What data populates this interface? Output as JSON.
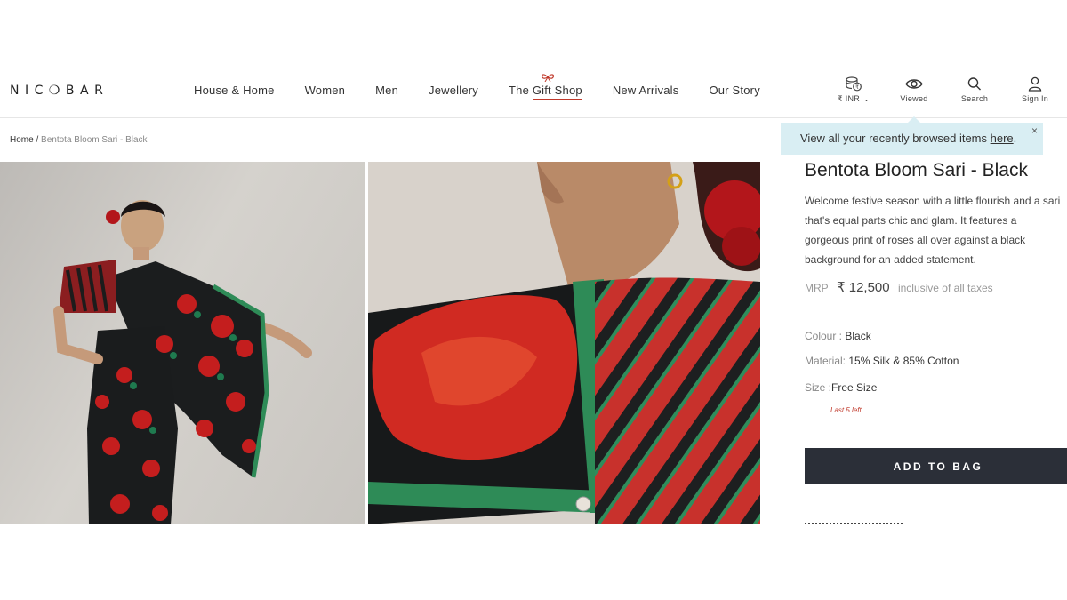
{
  "brand": {
    "logo_text": "NIC❍BAR"
  },
  "nav": {
    "items": [
      {
        "label": "House & Home"
      },
      {
        "label": "Women"
      },
      {
        "label": "Men"
      },
      {
        "label": "Jewellery"
      },
      {
        "label_prefix": "The ",
        "label_gift": "Gift Shop"
      },
      {
        "label": "New Arrivals"
      },
      {
        "label": "Our Story"
      }
    ]
  },
  "tools": {
    "currency": "₹ INR",
    "viewed": "Viewed",
    "search": "Search",
    "signin": "Sign In"
  },
  "tooltip": {
    "text": "View all your recently browsed items ",
    "link": "here",
    "suffix": ".",
    "close": "×"
  },
  "breadcrumb": {
    "home": "Home",
    "separator": " / ",
    "current": "Bentota Bloom Sari - Black"
  },
  "product": {
    "title": "Bentota Bloom Sari - Black",
    "description_lines": [
      "Welcome festive season with a little flourish and a sari",
      "that's equal parts chic and glam. It features a",
      "gorgeous print of roses all over against a black",
      "background for an added statement."
    ],
    "mrp_label": "MRP",
    "price": "₹ 12,500",
    "tax_note": "inclusive of all taxes",
    "colour_label": "Colour : ",
    "colour_value": "Black",
    "material_label": "Material: ",
    "material_value": "15% Silk & 85% Cotton",
    "size_label": "Size :",
    "size_value": "Free Size",
    "stock_note": "Last 5 left",
    "add_to_bag": "ADD TO BAG"
  },
  "colors": {
    "accent_dark": "#2b2f38",
    "tooltip_bg": "#d9eef3",
    "alert_red": "#c0392b"
  }
}
